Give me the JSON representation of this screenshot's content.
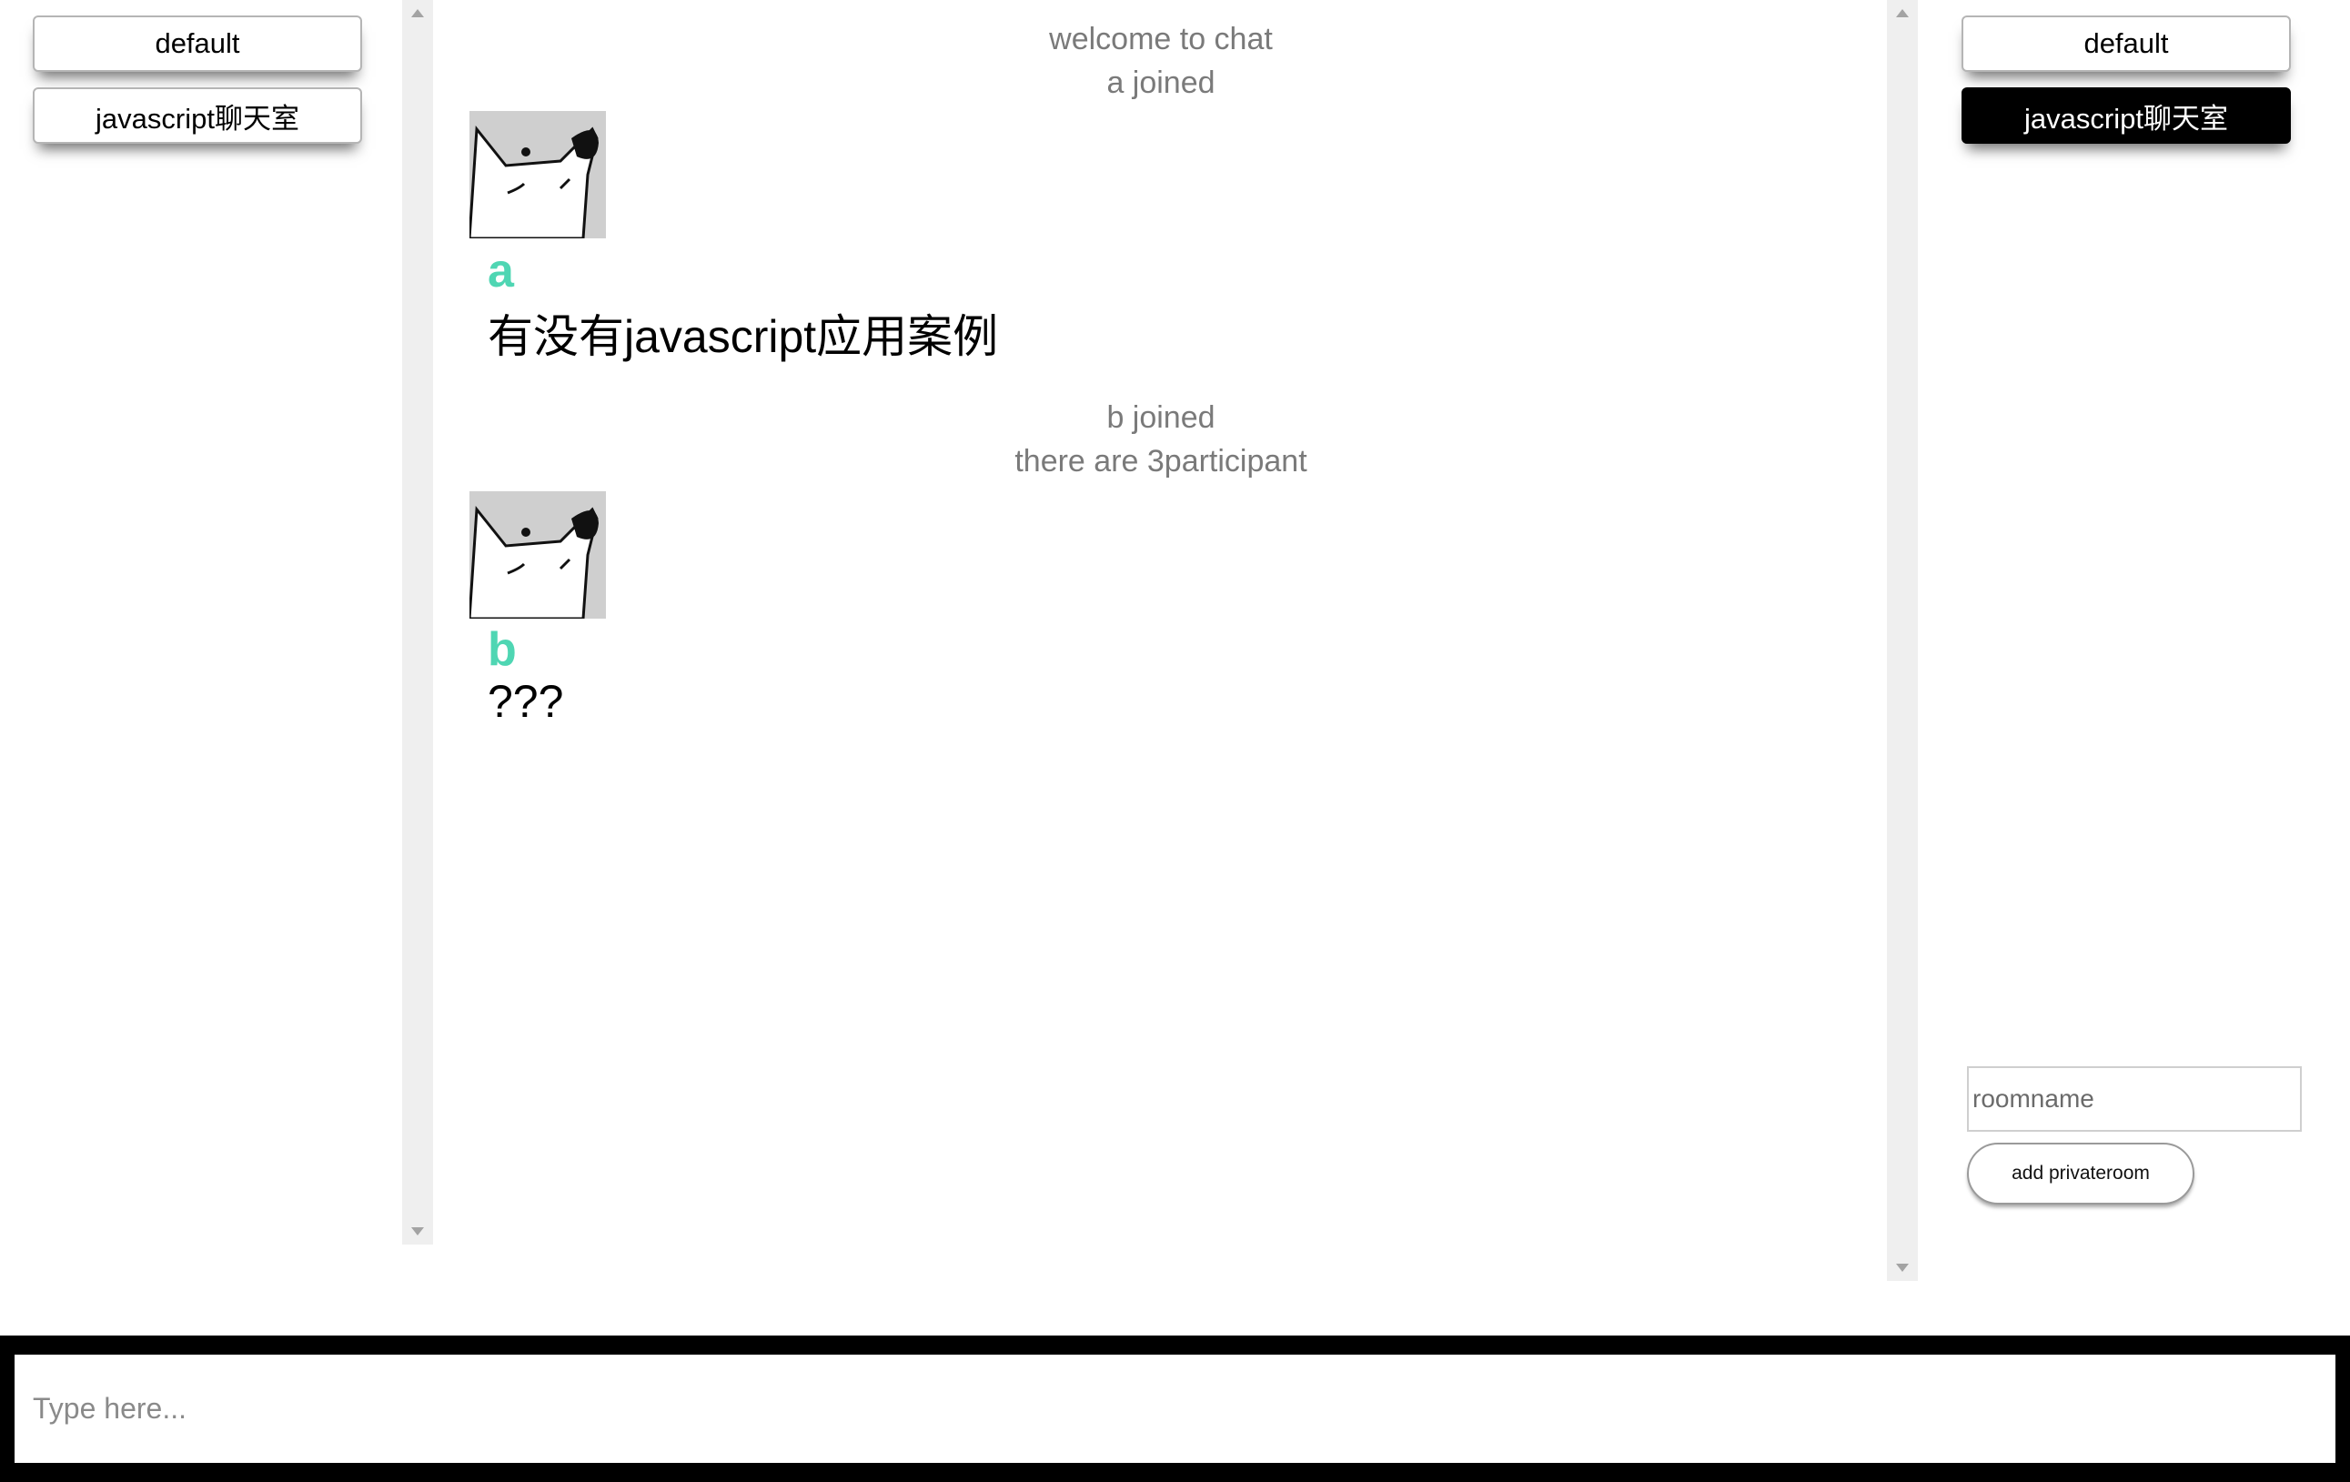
{
  "left_panel": {
    "rooms": [
      {
        "label": "default"
      },
      {
        "label": "javascript聊天室"
      }
    ]
  },
  "right_panel": {
    "rooms": [
      {
        "label": "default"
      },
      {
        "label": "javascript聊天室",
        "active": true
      }
    ],
    "roomname_placeholder": "roomname",
    "add_button_label": "add privateroom"
  },
  "chat": {
    "system_lines": [
      "welcome to chat",
      "a joined",
      "b joined",
      "there are 3participant"
    ],
    "messages": [
      {
        "user": "a",
        "text": "有没有javascript应用案例",
        "avatar": "dog-avatar-icon"
      },
      {
        "user": "b",
        "text": "???",
        "avatar": "dog-avatar-icon"
      }
    ]
  },
  "composer": {
    "placeholder": "Type here..."
  },
  "colors": {
    "username": "#4fd6b3",
    "active_room_bg": "#000000",
    "system_text": "#7a7a7a"
  }
}
